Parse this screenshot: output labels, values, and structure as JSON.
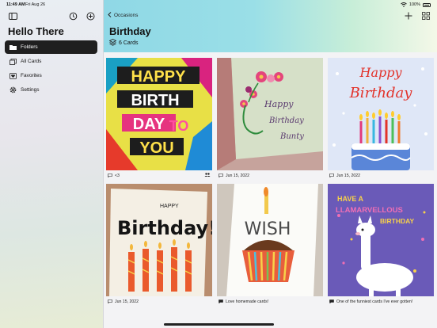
{
  "status": {
    "time": "11:49 AM",
    "date": "Fri Aug 26",
    "battery": "100%"
  },
  "sidebar": {
    "title": "Hello There",
    "items": [
      {
        "label": "Folders",
        "icon": "folder-icon",
        "active": true
      },
      {
        "label": "All Cards",
        "icon": "cards-icon",
        "active": false
      },
      {
        "label": "Favorites",
        "icon": "heart-icon",
        "active": false
      },
      {
        "label": "Settings",
        "icon": "gear-icon",
        "active": false
      }
    ]
  },
  "header": {
    "back_label": "Occasions",
    "title": "Birthday",
    "count": "6 Cards"
  },
  "cards": [
    {
      "art": "happy-birthday-to-you",
      "caption": "<3"
    },
    {
      "art": "quilled-flowers-bunty",
      "caption": "Jun 15, 2022"
    },
    {
      "art": "birthday-cake-candles",
      "caption": "Jun 15, 2022"
    },
    {
      "art": "handwritten-birthday",
      "caption": "Jun 15, 2022"
    },
    {
      "art": "wish-cupcake",
      "caption": "Love homemade cards!"
    },
    {
      "art": "llama-card",
      "caption": "One of the funniest cards I've ever gotten!"
    }
  ],
  "art_text": {
    "c1": [
      "HAPPY",
      "BIRTH",
      "DAY",
      "TO",
      "YOU"
    ],
    "c2": [
      "Happy",
      "Birthday",
      "Bunty"
    ],
    "c3": [
      "Happy",
      "Birthday"
    ],
    "c4": [
      "HAPPY",
      "Birthday!"
    ],
    "c5": [
      "WISH"
    ],
    "c6": [
      "HAVE A",
      "LLAMARVELLOUS",
      "BIRTHDAY"
    ]
  },
  "colors": {
    "accent": "#1f1f1f",
    "header_start": "#8fd8e6",
    "header_end": "#f4f8e8"
  }
}
